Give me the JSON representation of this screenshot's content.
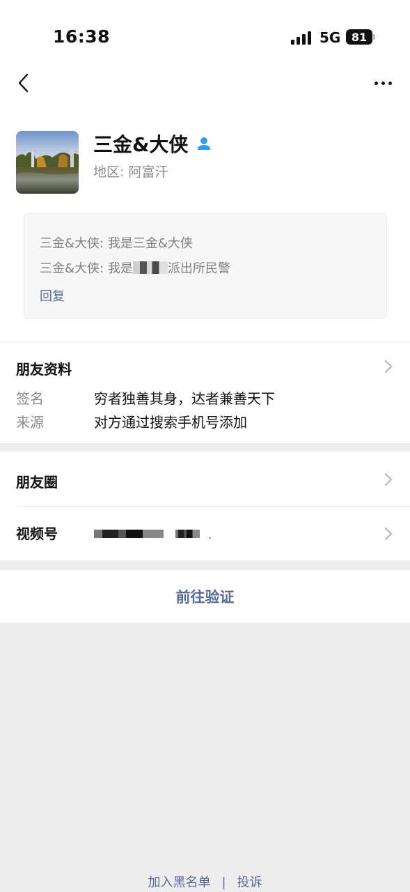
{
  "status_bar": {
    "time": "16:38",
    "network": "5G",
    "battery": "81"
  },
  "nav": {
    "back_icon": "chevron-left-icon",
    "more_icon": "more-dots-icon"
  },
  "profile": {
    "nickname": "三金&大侠",
    "region": "地区: 阿富汗",
    "badge_icon": "person-icon"
  },
  "messages": {
    "line1": "三金&大侠: 我是三金&大侠",
    "line2_prefix": "三金&大侠: 我是",
    "line2_suffix": "派出所民警",
    "reply_label": "回复"
  },
  "friend_info": {
    "title": "朋友资料",
    "signature_label": "签名",
    "signature_value": "穷者独善其身，达者兼善天下",
    "source_label": "来源",
    "source_value": "对方通过搜索手机号添加"
  },
  "moments": {
    "label": "朋友圈"
  },
  "channels": {
    "label": "视频号",
    "trailing_mark": "."
  },
  "actions": {
    "verify_label": "前往验证"
  },
  "footer": {
    "blacklist_label": "加入黑名单",
    "separator": "|",
    "report_label": "投诉"
  },
  "colors": {
    "link": "#576b95",
    "background": "#ededed",
    "verified_badge": "#2b9ef0"
  }
}
